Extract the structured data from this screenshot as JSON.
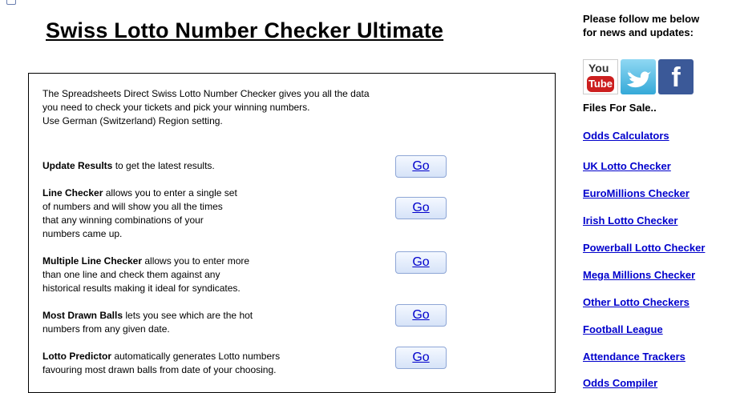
{
  "page": {
    "title": "Swiss Lotto Number Checker Ultimate"
  },
  "intro": {
    "line1": "The Spreadsheets Direct Swiss Lotto Number Checker gives you all the data",
    "line2": "you need to check your tickets and pick your winning numbers.",
    "line3": "Use German (Switzerland) Region setting."
  },
  "features": [
    {
      "name": "Update Results",
      "lines": [
        " to get the latest results."
      ],
      "button": "Go"
    },
    {
      "name": "Line Checker",
      "lines": [
        " allows you to enter a single set",
        "of numbers and will show you all the times",
        "that any winning combinations of your",
        "numbers came up."
      ],
      "button": "Go"
    },
    {
      "name": "Multiple Line Checker",
      "lines": [
        " allows you to enter more",
        "than one line and check them against any",
        "historical results making it ideal for syndicates."
      ],
      "button": "Go"
    },
    {
      "name": "Most Drawn Balls",
      "lines": [
        " lets you see which are the hot",
        "numbers from any given date."
      ],
      "button": "Go"
    },
    {
      "name": "Lotto Predictor",
      "lines": [
        " automatically generates Lotto numbers",
        "favouring most drawn balls from date of your choosing."
      ],
      "button": "Go"
    }
  ],
  "sidebar": {
    "follow_line1": "Please follow me below",
    "follow_line2": "for news and updates:",
    "social": {
      "youtube_you": "You",
      "youtube_tube": "Tube",
      "facebook": "f"
    },
    "files_heading": "Files For Sale..",
    "links": [
      "Odds Calculators",
      "UK Lotto Checker",
      "EuroMillions Checker",
      "Irish Lotto Checker",
      "Powerball Lotto Checker",
      "Mega Millions Checker",
      "Other Lotto Checkers",
      "Football League",
      "Attendance Trackers",
      "Odds Compiler"
    ]
  }
}
